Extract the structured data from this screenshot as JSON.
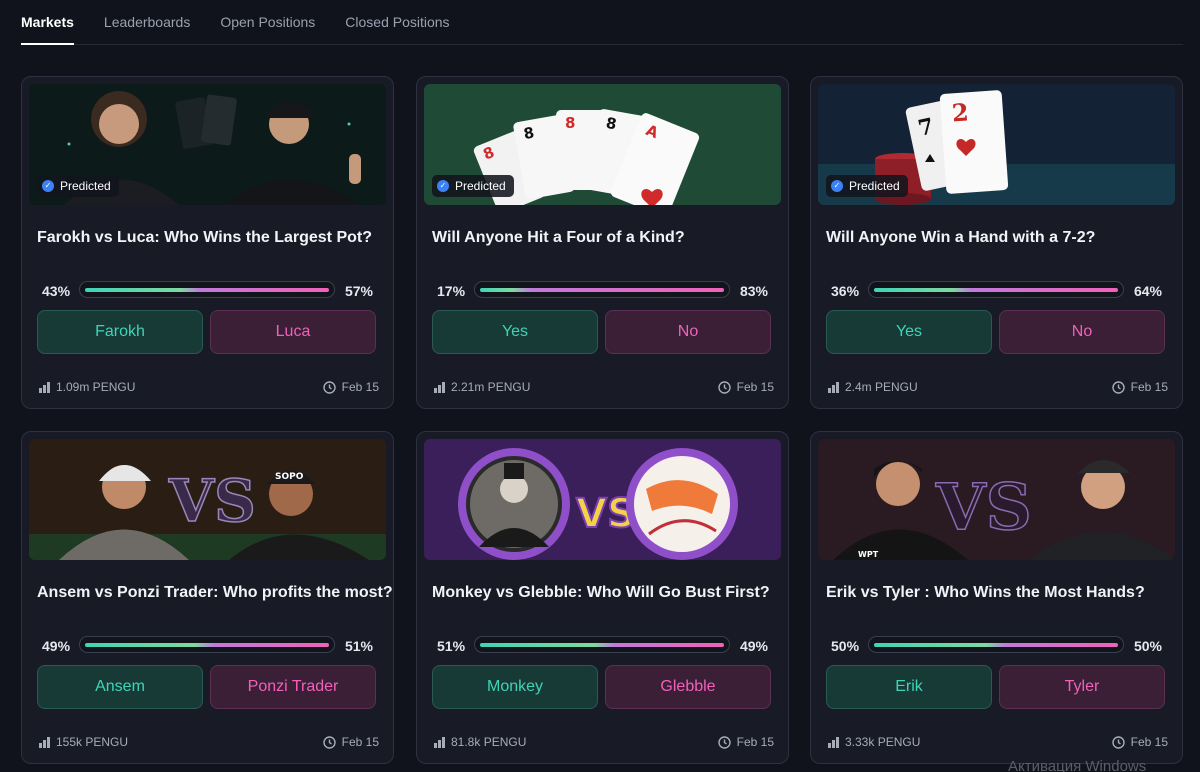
{
  "tabs": [
    {
      "label": "Markets",
      "active": true
    },
    {
      "label": "Leaderboards",
      "active": false
    },
    {
      "label": "Open Positions",
      "active": false
    },
    {
      "label": "Closed Positions",
      "active": false
    }
  ],
  "badge_label": "Predicted",
  "colors": {
    "yes": "#3fd4b6",
    "no": "#f062b8",
    "bg": "#11131c",
    "card": "#181b26"
  },
  "cards": [
    {
      "title": "Farokh vs Luca: Who Wins the Largest Pot?",
      "left_pct": "43%",
      "right_pct": "57%",
      "yes_share": 0.43,
      "yes_label": "Farokh",
      "no_label": "Luca",
      "volume": "1.09m PENGU",
      "date": "Feb 15",
      "predicted": true
    },
    {
      "title": "Will Anyone Hit a Four of a Kind?",
      "left_pct": "17%",
      "right_pct": "83%",
      "yes_share": 0.17,
      "yes_label": "Yes",
      "no_label": "No",
      "volume": "2.21m PENGU",
      "date": "Feb 15",
      "predicted": true
    },
    {
      "title": "Will Anyone Win a Hand with a 7-2?",
      "left_pct": "36%",
      "right_pct": "64%",
      "yes_share": 0.36,
      "yes_label": "Yes",
      "no_label": "No",
      "volume": "2.4m PENGU",
      "date": "Feb 15",
      "predicted": true
    },
    {
      "title": "Ansem vs Ponzi Trader: Who profits the most?",
      "left_pct": "49%",
      "right_pct": "51%",
      "yes_share": 0.49,
      "yes_label": "Ansem",
      "no_label": "Ponzi Trader",
      "volume": "155k PENGU",
      "date": "Feb 15",
      "predicted": false
    },
    {
      "title": "Monkey vs Glebble: Who Will Go Bust First?",
      "left_pct": "51%",
      "right_pct": "49%",
      "yes_share": 0.51,
      "yes_label": "Monkey",
      "no_label": "Glebble",
      "volume": "81.8k PENGU",
      "date": "Feb 15",
      "predicted": false
    },
    {
      "title": "Erik vs Tyler : Who Wins the Most Hands?",
      "left_pct": "50%",
      "right_pct": "50%",
      "yes_share": 0.5,
      "yes_label": "Erik",
      "no_label": "Tyler",
      "volume": "3.33k PENGU",
      "date": "Feb 15",
      "predicted": false
    }
  ],
  "image_text": {
    "vs": "VS",
    "card_ranks": [
      "8",
      "8",
      "8",
      "8",
      "A"
    ],
    "card72": [
      "7",
      "2"
    ],
    "cap1": "SOPO",
    "cap2": "WPT"
  },
  "watermark": "Активация Windows"
}
